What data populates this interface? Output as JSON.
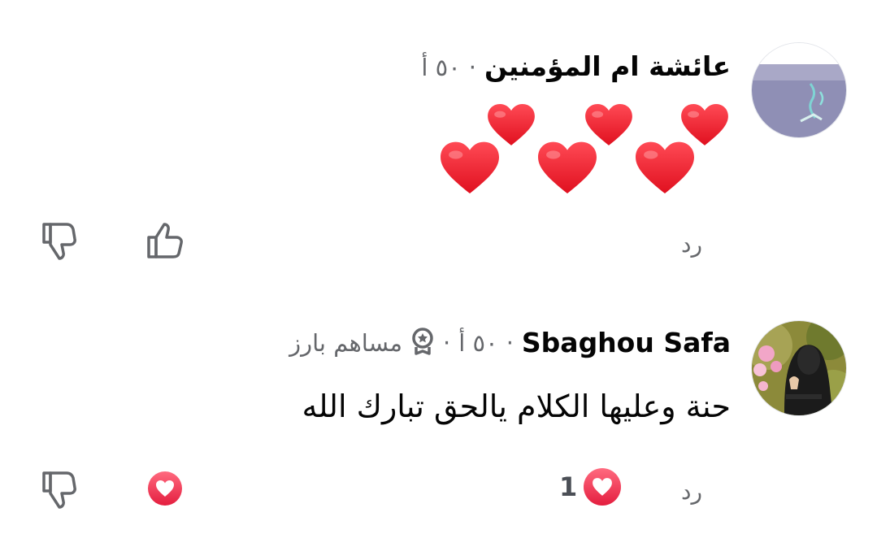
{
  "comments": [
    {
      "author": "عائشة ام المؤمنين",
      "time": "٥٠ أ",
      "separator": "·",
      "emoji_text": "❤️❤️❤️❤️❤️❤️",
      "reply_label": "رد",
      "avatar_icon": "watercolor-avatar"
    },
    {
      "author": "Sbaghou Safa",
      "time": "٥٠ أ",
      "separator": "·",
      "badge_label": "مساهم بارز",
      "badge_icon": "top-contributor-icon",
      "text": "حنة وعليها الكلام يالحق تبارك الله",
      "reply_label": "رد",
      "reaction_count": "1",
      "avatar_icon": "hijab-girl-avatar"
    }
  ],
  "colors": {
    "heart": "#f1283e",
    "love_badge": "#f0334e",
    "icon_gray": "#65676b"
  }
}
